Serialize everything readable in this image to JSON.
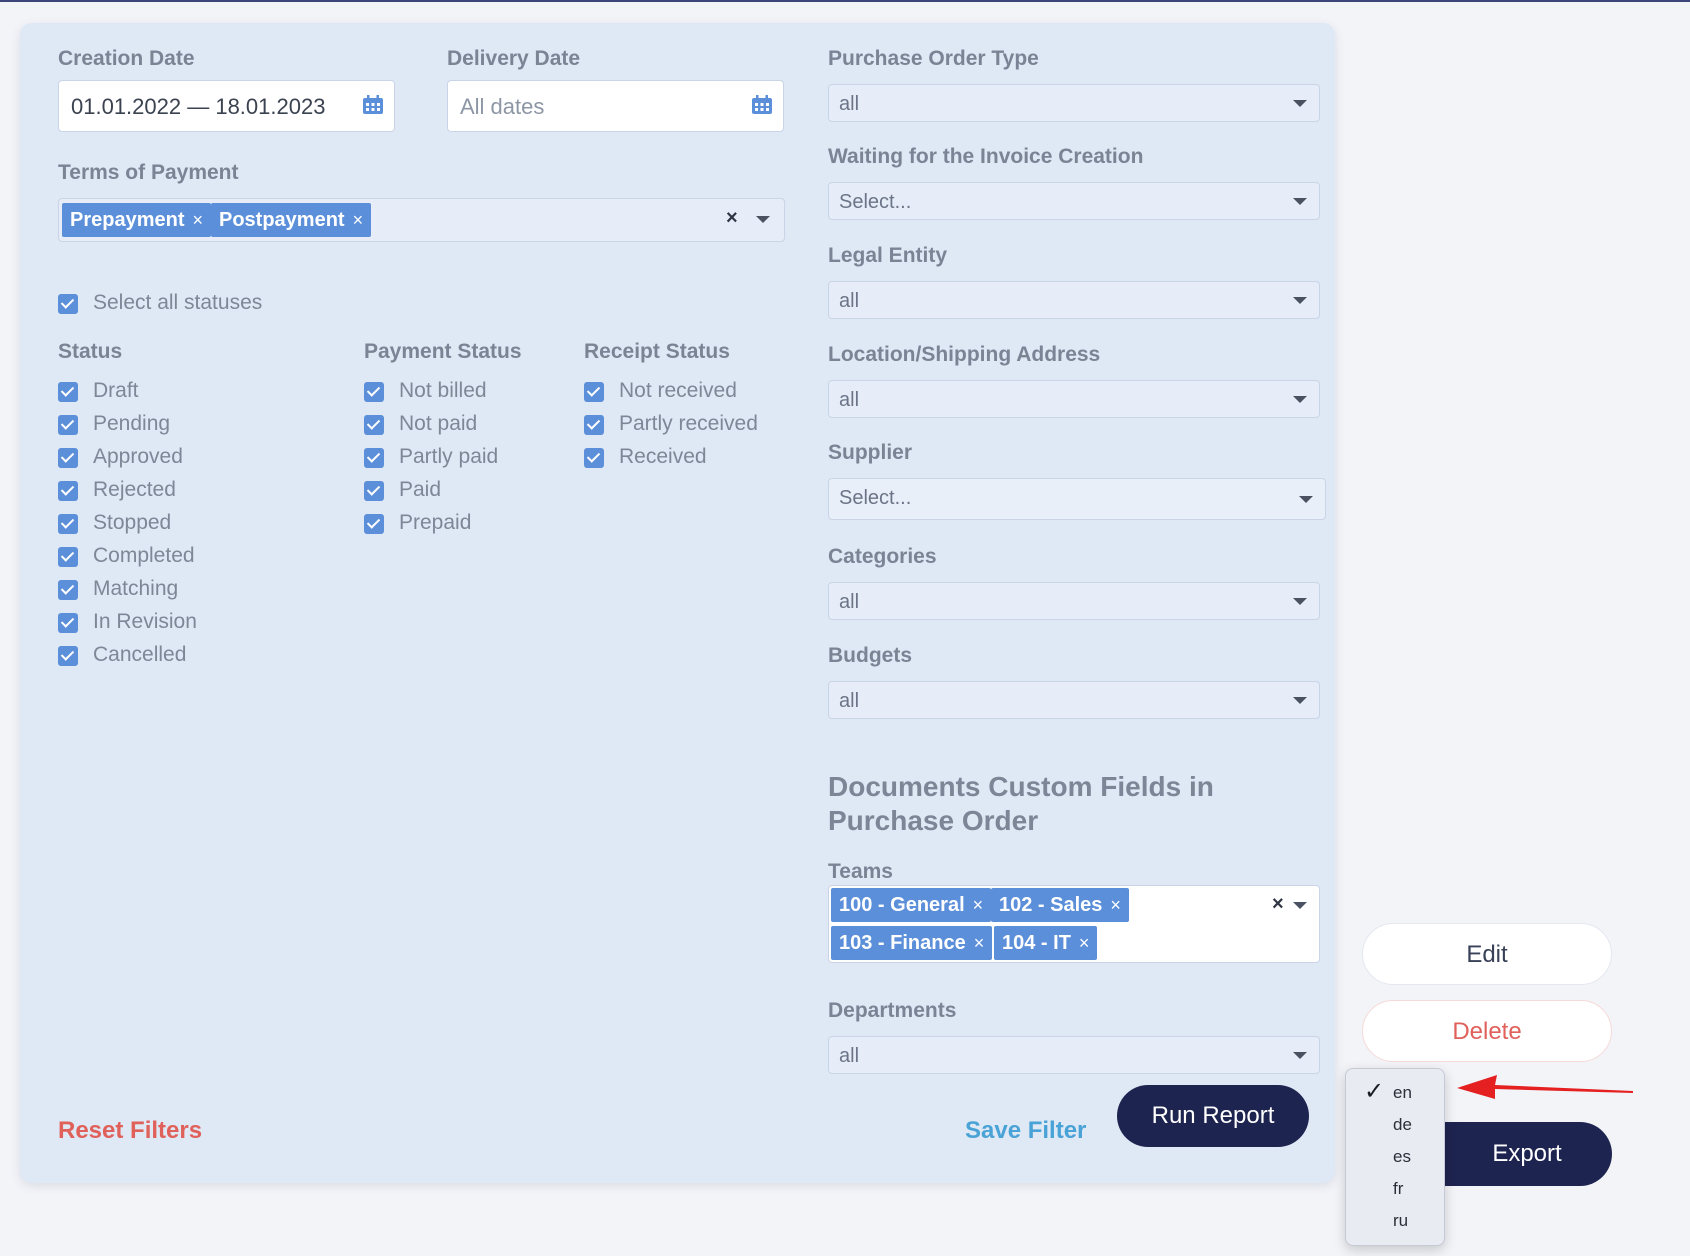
{
  "filters": {
    "creation_date": {
      "label": "Creation Date",
      "value": "01.01.2022 — 18.01.2023"
    },
    "delivery_date": {
      "label": "Delivery Date",
      "placeholder": "All dates"
    },
    "terms_of_payment": {
      "label": "Terms of Payment",
      "tags": [
        "Prepayment",
        "Postpayment"
      ]
    },
    "select_all_statuses": "Select all statuses",
    "status": {
      "label": "Status",
      "items": [
        "Draft",
        "Pending",
        "Approved",
        "Rejected",
        "Stopped",
        "Completed",
        "Matching",
        "In Revision",
        "Cancelled"
      ]
    },
    "payment_status": {
      "label": "Payment Status",
      "items": [
        "Not billed",
        "Not paid",
        "Partly paid",
        "Paid",
        "Prepaid"
      ]
    },
    "receipt_status": {
      "label": "Receipt Status",
      "items": [
        "Not received",
        "Partly received",
        "Received"
      ]
    },
    "purchase_order_type": {
      "label": "Purchase Order Type",
      "value": "all"
    },
    "waiting_invoice": {
      "label": "Waiting for the Invoice Creation",
      "value": "Select..."
    },
    "legal_entity": {
      "label": "Legal Entity",
      "value": "all"
    },
    "location": {
      "label": "Location/Shipping Address",
      "value": "all"
    },
    "supplier": {
      "label": "Supplier",
      "value": "Select..."
    },
    "categories": {
      "label": "Categories",
      "value": "all"
    },
    "budgets": {
      "label": "Budgets",
      "value": "all"
    },
    "custom_fields_title": "Documents Custom Fields in Purchase Order",
    "teams": {
      "label": "Teams",
      "tags": [
        "100 - General",
        "102 - Sales",
        "103 - Finance",
        "104 - IT"
      ]
    },
    "departments": {
      "label": "Departments",
      "value": "all"
    }
  },
  "actions": {
    "reset": "Reset Filters",
    "save": "Save Filter",
    "run": "Run Report",
    "edit": "Edit",
    "delete": "Delete",
    "export": "Export"
  },
  "language_menu": {
    "selected": "en",
    "options": [
      "en",
      "de",
      "es",
      "fr",
      "ru"
    ]
  },
  "colors": {
    "accent": "#5b8fd9",
    "dark_button": "#1e2450",
    "danger": "#e0605a",
    "link": "#4aa3d6",
    "panel_bg": "#dfe8f5"
  }
}
